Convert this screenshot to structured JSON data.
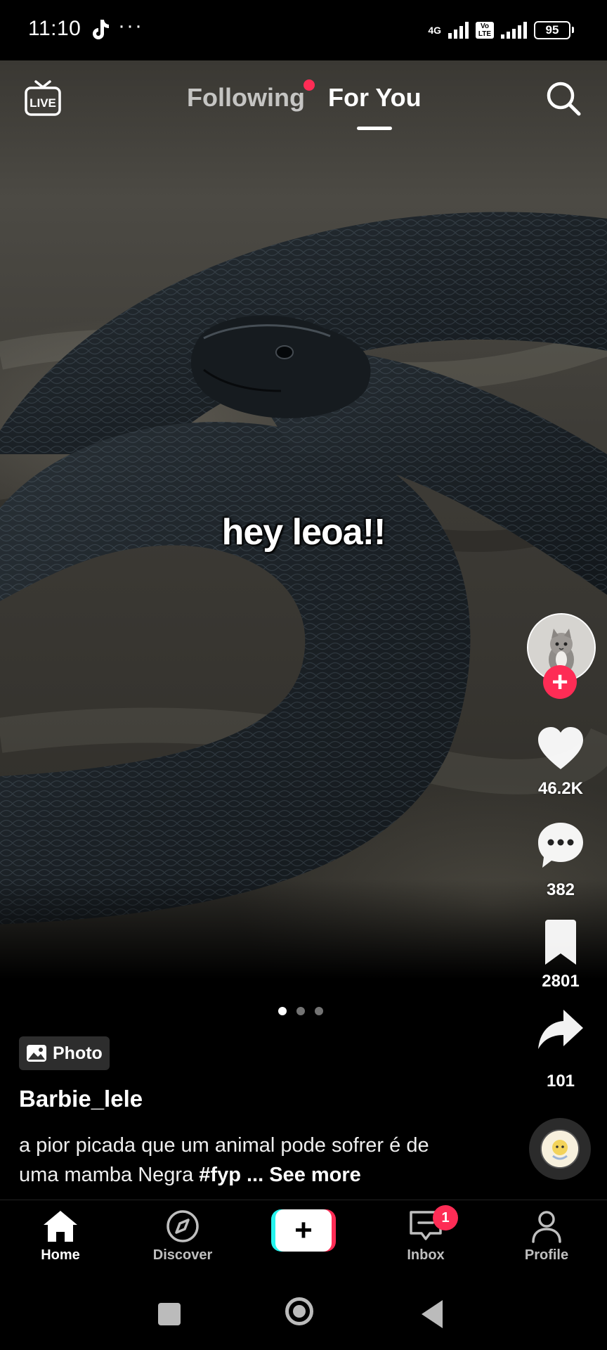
{
  "status_bar": {
    "time": "11:10",
    "more": "···",
    "network": "4G",
    "volte": "Vo LTE",
    "battery": "95"
  },
  "top_nav": {
    "live_label": "LIVE",
    "tabs": [
      {
        "label": "Following",
        "has_dot": true,
        "active": false
      },
      {
        "label": "For You",
        "active": true
      }
    ]
  },
  "post": {
    "overlay_text": "hey leoa!!",
    "type_badge": "Photo",
    "username": "Barbie_lele",
    "description": "a pior picada que um animal pode sofrer é de uma mamba Negra",
    "hashtag": "#fyp",
    "ellipsis": "...",
    "see_more": "See more",
    "carousel": {
      "count": 3,
      "active_index": 0
    }
  },
  "actions": {
    "likes": "46.2K",
    "comments": "382",
    "bookmarks": "2801",
    "shares": "101"
  },
  "bottom_nav": {
    "items": [
      {
        "label": "Home",
        "icon": "home-icon",
        "active": true
      },
      {
        "label": "Discover",
        "icon": "compass-icon"
      },
      {
        "label": "Inbox",
        "icon": "inbox-icon",
        "badge": "1"
      },
      {
        "label": "Profile",
        "icon": "profile-icon"
      }
    ],
    "create_icon": "+"
  },
  "colors": {
    "accent_red": "#fe2c55",
    "accent_cyan": "#25f4ee",
    "background": "#000000"
  }
}
